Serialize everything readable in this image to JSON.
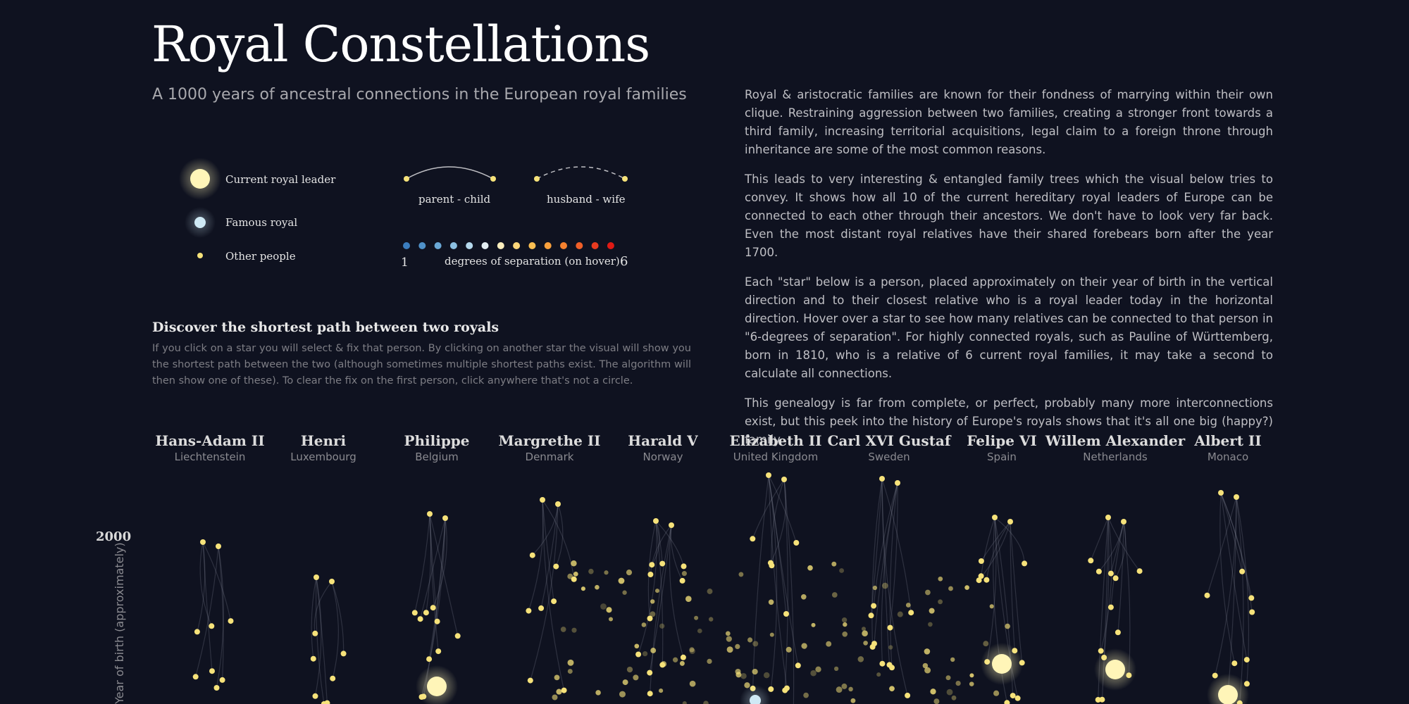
{
  "header": {
    "title": "Royal Constellations",
    "subtitle": "A 1000 years of ancestral connections in the European royal families"
  },
  "intro": {
    "paragraphs": [
      "Royal & aristocratic families are known for their fondness of marrying within their own clique. Restraining aggression between two families, creating a stronger front towards a third family, increasing territorial acquisitions, legal claim to a foreign throne through inheritance are some of the most common reasons.",
      "This leads to very interesting & entangled family trees which the visual below tries to convey. It shows how all 10 of the current hereditary royal leaders of Europe can be connected to each other through their ancestors. We don't have to look very far back. Even the most distant royal relatives have their shared forebears born after the year 1700.",
      "Each \"star\" below is a person, placed approximately on their year of birth in the vertical direction and to their closest relative who is a royal leader today in the horizontal direction. Hover over a star to see how many relatives can be connected to that person in \"6-degrees of separation\". For highly connected royals, such as Pauline of Württemberg, born in 1810, who is a relative of 6 current royal families, it may take a second to calculate all connections.",
      "This genealogy is far from complete, or perfect, probably many more interconnections exist, but this peek into the history of Europe's royals shows that it's all one big (happy?) family."
    ]
  },
  "legend": {
    "current_leader": "Current royal leader",
    "famous_royal": "Famous royal",
    "other_people": "Other people",
    "parent_child": "parent - child",
    "husband_wife": "husband - wife",
    "degrees_label": "degrees of separation (on hover)",
    "degrees_min": "1",
    "degrees_max": "6",
    "degree_colors": [
      "#3b7dbf",
      "#4f91c9",
      "#6aa8d6",
      "#8cc0e2",
      "#b4d8ec",
      "#e3eef2",
      "#fbeebd",
      "#fbd67a",
      "#fbbf52",
      "#f9a03c",
      "#f5812f",
      "#f05f28",
      "#e83b20",
      "#e01a14"
    ],
    "colors": {
      "current_leader": "#fff5b8",
      "famous_royal": "#cfe9f5",
      "other_people": "#f6e27a"
    }
  },
  "discover": {
    "title": "Discover the shortest path between two royals",
    "text": "If you click on a star you will select & fix that person. By clicking on another star the visual will show you the shortest path between the two (although sometimes multiple shortest paths exist. The algorithm will then show one of these). To clear the fix on the first person, click anywhere that's not a circle."
  },
  "leaders": [
    {
      "name": "Hans-Adam II",
      "country": "Liechtenstein"
    },
    {
      "name": "Henri",
      "country": "Luxembourg"
    },
    {
      "name": "Philippe",
      "country": "Belgium"
    },
    {
      "name": "Margrethe II",
      "country": "Denmark"
    },
    {
      "name": "Harald V",
      "country": "Norway"
    },
    {
      "name": "Elizabeth II",
      "country": "United Kingdom"
    },
    {
      "name": "Carl XVI Gustaf",
      "country": "Sweden"
    },
    {
      "name": "Felipe VI",
      "country": "Spain"
    },
    {
      "name": "Willem Alexander",
      "country": "Netherlands"
    },
    {
      "name": "Albert II",
      "country": "Monaco"
    }
  ],
  "axis": {
    "year_tick": "2000",
    "y_label": "Year of birth (approximately)"
  }
}
